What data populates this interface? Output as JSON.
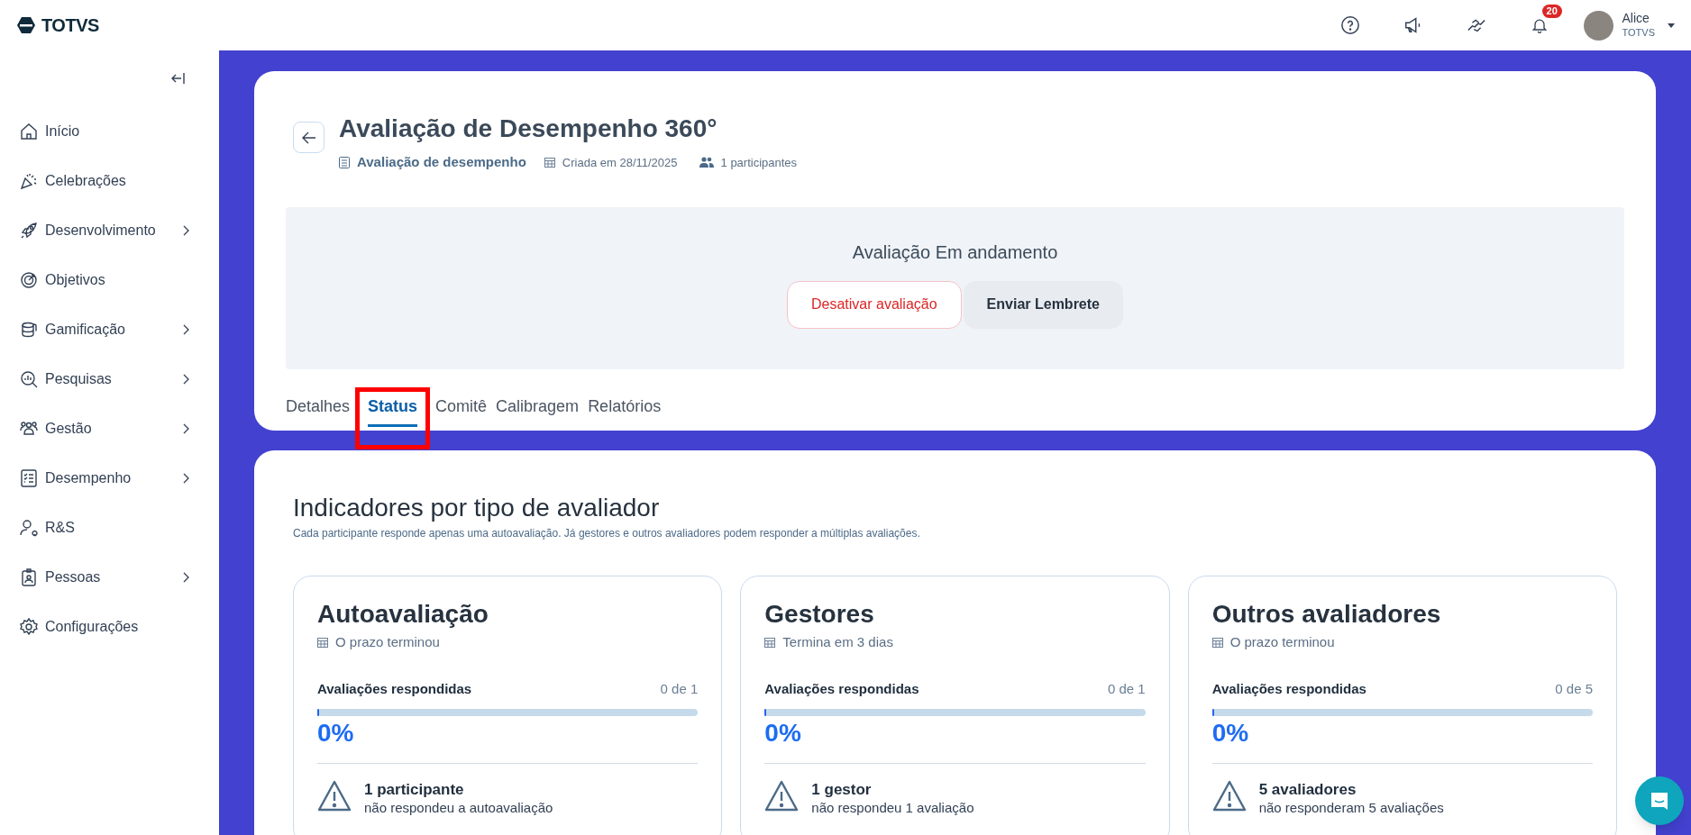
{
  "logo": {
    "text": "TOTVS"
  },
  "topbar": {
    "notifications_count": "20",
    "user": {
      "name": "Alice",
      "company": "TOTVS"
    }
  },
  "sidebar": {
    "items": [
      {
        "label": "Início",
        "has_submenu": false
      },
      {
        "label": "Celebrações",
        "has_submenu": false
      },
      {
        "label": "Desenvolvimento",
        "has_submenu": true
      },
      {
        "label": "Objetivos",
        "has_submenu": false
      },
      {
        "label": "Gamificação",
        "has_submenu": true
      },
      {
        "label": "Pesquisas",
        "has_submenu": true
      },
      {
        "label": "Gestão",
        "has_submenu": true
      },
      {
        "label": "Desempenho",
        "has_submenu": true
      },
      {
        "label": "R&S",
        "has_submenu": false
      },
      {
        "label": "Pessoas",
        "has_submenu": true
      },
      {
        "label": "Configurações",
        "has_submenu": false
      }
    ]
  },
  "header": {
    "title": "Avaliação de Desempenho 360°",
    "type": "Avaliação de desempenho",
    "created": "Criada em 28/11/2025",
    "participants": "1 participantes"
  },
  "status_panel": {
    "title": "Avaliação Em andamento",
    "buttons": [
      {
        "label": "Desativar avaliação",
        "kind": "danger"
      },
      {
        "label": "Enviar Lembrete",
        "kind": "secondary"
      }
    ]
  },
  "tabs": [
    {
      "label": "Detalhes",
      "selected": false
    },
    {
      "label": "Status",
      "selected": true
    },
    {
      "label": "Comitê",
      "selected": false
    },
    {
      "label": "Calibragem",
      "selected": false
    },
    {
      "label": "Relatórios",
      "selected": false
    }
  ],
  "indicators": {
    "title": "Indicadores por tipo de avaliador",
    "subtitle": "Cada participante responde apenas uma autoavaliação. Já gestores e outros avaliadores podem responder a múltiplas avaliações.",
    "cards": [
      {
        "title": "Autoavaliação",
        "deadline": "O prazo terminou",
        "progress_label": "Avaliações respondidas",
        "count": "0 de 1",
        "level": 0,
        "percent": "0%",
        "warning_title": "1 participante",
        "warning_text": "não respondeu a autoavaliação"
      },
      {
        "title": "Gestores",
        "deadline": "Termina em 3 dias",
        "progress_label": "Avaliações respondidas",
        "count": "0 de 1",
        "level": 0,
        "percent": "0%",
        "warning_title": "1 gestor",
        "warning_text": "não respondeu 1 avaliação"
      },
      {
        "title": "Outros avaliadores",
        "deadline": "O prazo terminou",
        "progress_label": "Avaliações respondidas",
        "count": "0 de 5",
        "level": 0,
        "percent": "0%",
        "warning_title": "5 avaliadores",
        "warning_text": "não responderam 5 avaliações"
      }
    ]
  }
}
